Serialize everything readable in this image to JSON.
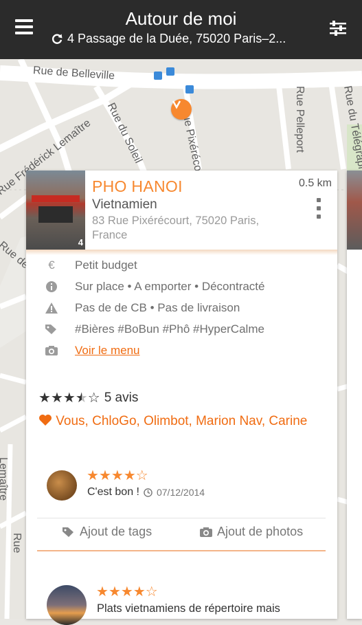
{
  "header": {
    "title": "Autour de moi",
    "address": "4 Passage de la Duée, 75020 Paris–2..."
  },
  "map": {
    "streets": [
      "Rue de Belleville",
      "Rue du Soleil",
      "Rue Pixérécourt",
      "Rue Pelleport",
      "Rue du Télégraphe",
      "Rue Frédérick Lemaître",
      "Rue de",
      "Lemaître",
      "Rue"
    ]
  },
  "card": {
    "name": "PHO HANOI",
    "distance": "0.5 km",
    "cuisine": "Vietnamien",
    "address": "83 Rue Pixérécourt, 75020 Paris, France",
    "photo_count": "4",
    "info": {
      "budget": "Petit budget",
      "services": "Sur place • A emporter • Décontracté",
      "warnings": "Pas de de CB • Pas de livraison",
      "tags": "#Bières #BoBun #Phô #HyperCalme",
      "menu_link": "Voir le menu"
    },
    "rating": {
      "stars": 3.5,
      "reviews": "5 avis"
    },
    "likes": "Vous, ChloGo, Olimbot, Marion Nav, Carine",
    "review1": {
      "stars": 4,
      "text": "C'est bon !",
      "date": "07/12/2014"
    },
    "actions": {
      "tags": "Ajout de tags",
      "photos": "Ajout de photos"
    },
    "review2": {
      "stars": 4,
      "text": "Plats vietnamiens de répertoire mais"
    }
  },
  "colors": {
    "accent": "#f7882f",
    "topbar": "#2b2b2b"
  }
}
